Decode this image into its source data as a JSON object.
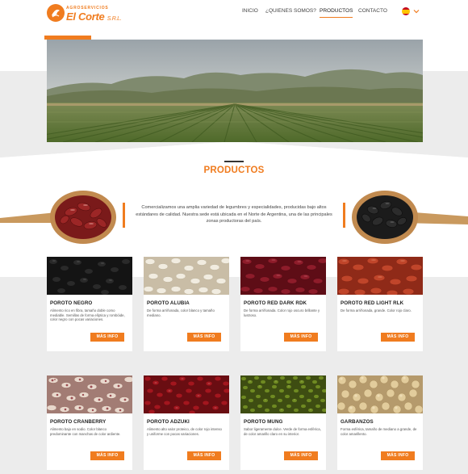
{
  "brand": {
    "small_text": "AGROSERVICIOS",
    "name": "El Corte",
    "suffix": "S.R.L.",
    "accent_color": "#f07c1f"
  },
  "nav": {
    "items": [
      {
        "label": "INICIO"
      },
      {
        "label": "¿QUIENES SOMOS?"
      },
      {
        "label": "PRODUCTOS",
        "active": true
      },
      {
        "label": "CONTACTO"
      }
    ],
    "language_flag": "spain-flag-icon"
  },
  "products_section": {
    "title": "PRODUCTOS",
    "intro": "Comercializamos una amplia variedad de legumbres y especialidades, producidas bajo altos estándares de calidad. Nuestra sede está ubicada en el Norte de Argentina, una de las principales zonas productoras del país."
  },
  "products": [
    {
      "name": "POROTO NEGRO",
      "description": "Alimento rico en fibra, tamaño doble como mediable. Semillas de forma elíptica y rombóide, color negro con pocas variaciones.",
      "button": "MÁS INFO",
      "bean": "black"
    },
    {
      "name": "POROTO ALUBIA",
      "description": "De forma arriñonada, color blanco y tamaño mediano.",
      "button": "MÁS INFO",
      "bean": "white"
    },
    {
      "name": "POROTO RED DARK RDK",
      "description": "De forma arriñonada. Color rojo oscuro brillante y lustroso.",
      "button": "MÁS INFO",
      "bean": "darkred"
    },
    {
      "name": "POROTO RED LIGHT RLK",
      "description": "De forma arriñonada, grande. Color rojo claro.",
      "button": "MÁS INFO",
      "bean": "lightred"
    },
    {
      "name": "POROTO CRANBERRY",
      "description": "Alimento bajo en sodio. Color blanco predominante con manchas de color ardiente.",
      "button": "MÁS INFO",
      "bean": "cranberry"
    },
    {
      "name": "POROTO ADZUKI",
      "description": "Alimento alto valor proteico, de color rojo intenso y uniforme con pocas variaciones.",
      "button": "MÁS INFO",
      "bean": "adzuki"
    },
    {
      "name": "POROTO MUNG",
      "description": "Sabor ligeramente dulce. Verde de forma esférica, de color amarillo claro en su interior.",
      "button": "MÁS INFO",
      "bean": "mung"
    },
    {
      "name": "GARBANZOS",
      "description": "Forma esférica, tamaño de mediano a grande, de color amarillento.",
      "button": "MÁS INFO",
      "bean": "chickpea"
    }
  ]
}
